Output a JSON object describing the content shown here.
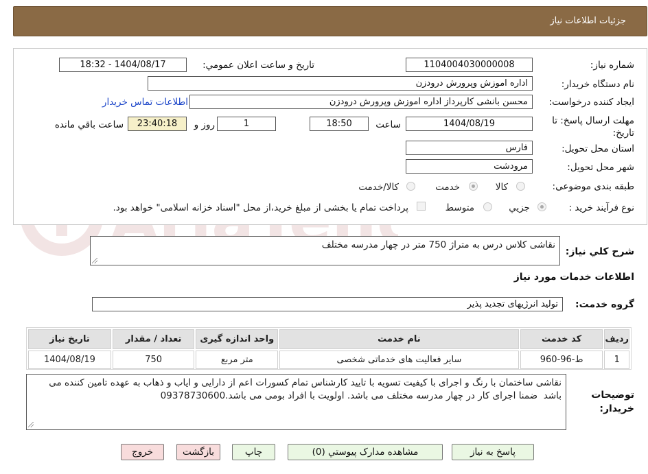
{
  "header": {
    "title": "جزئیات اطلاعات نیاز"
  },
  "form": {
    "need_number_label": "شماره نیاز:",
    "need_number": "1104004030000008",
    "announce_label": "تاریخ و ساعت اعلان عمومي:",
    "announce_value": "1404/08/17 - 18:32",
    "buyer_org_label": "نام دستگاه خريدار:",
    "buyer_org": "اداره اموزش وپرورش درودزن",
    "creator_label": "ايجاد کننده درخواست:",
    "creator": "محسن بانشی کارپرداز اداره اموزش وپرورش درودزن",
    "contact_link": "اطلاعات تماس خريدار",
    "deadline_label": "مهلت ارسال پاسخ: تا تاريخ:",
    "deadline_date": "1404/08/19",
    "time_label": "ساعت",
    "deadline_time": "18:50",
    "days_value": "1",
    "days_label": "روز و",
    "remaining_time": "23:40:18",
    "remaining_label": "ساعت باقي مانده",
    "province_label": "استان محل تحويل:",
    "province": "فارس",
    "city_label": "شهر محل تحويل:",
    "city": "مرودشت",
    "category_label": "طبقه بندی موضوعی:",
    "category_options": [
      "کالا",
      "خدمت",
      "کالا/خدمت"
    ],
    "category_selected": "خدمت",
    "process_label": "نوع فرآيند خريد :",
    "process_options": [
      "جزيي",
      "متوسط"
    ],
    "process_selected": "جزيي",
    "payment_note": "پرداخت تمام یا بخشی از مبلغ خرید،از محل \"اسناد خزانه اسلامی\" خواهد بود."
  },
  "description": {
    "label": "شرح کلي نياز:",
    "value": "نقاشی کلاس درس به متراژ 750 متر در چهار مدرسه مختلف"
  },
  "services": {
    "section_title": "اطلاعات خدمات مورد نياز",
    "group_label": "گروه خدمت:",
    "group_value": "تولید انرژیهای تجدید پذیر",
    "columns": [
      "رديف",
      "کد خدمت",
      "نام خدمت",
      "واحد اندازه گيری",
      "تعداد / مقدار",
      "تاريخ نياز"
    ],
    "rows": [
      [
        "1",
        "ط-96-960",
        "سایر فعالیت های خدماتی شخصی",
        "متر مربع",
        "750",
        "1404/08/19"
      ]
    ]
  },
  "buyer_notes": {
    "label": "توضيحات خريدار:",
    "value": "نقاشی ساختمان با رنگ و اجرای با کیفیت تسویه با تایید کارشناس تمام کسورات اعم از دارایی و ایاب و ذهاب به عهده تامین کننده می باشد  ضمنا اجرای کار در چهار مدرسه مختلف می باشد. اولویت با افراد بومی می باشد.09378730600"
  },
  "buttons": {
    "reply": "پاسخ به نياز",
    "attachments": "مشاهده مدارک پيوستي (0)",
    "print": "چاپ",
    "back": "بازگشت",
    "exit": "خروج"
  },
  "colors": {
    "header_bg": "#8a6a45",
    "button_green": "#eaf7e3",
    "button_pink": "#f8dcdc",
    "link": "#1a44c8"
  }
}
